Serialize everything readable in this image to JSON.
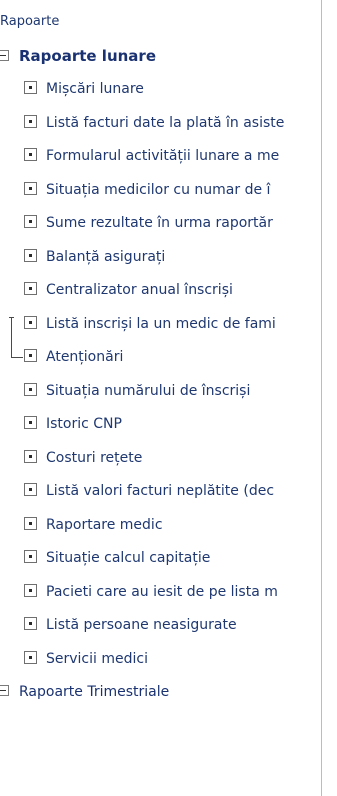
{
  "tree": {
    "root_label": "Rapoarte",
    "groups": [
      {
        "label": "Rapoarte lunare",
        "icon": "collapse-box-icon",
        "items": [
          {
            "label": "Mișcări lunare",
            "icon": "report-node-icon"
          },
          {
            "label": "Listă facturi date la plată în asiste",
            "icon": "report-node-icon"
          },
          {
            "label": "Formularul activității lunare a me",
            "icon": "report-node-icon"
          },
          {
            "label": "Situația medicilor cu numar de î",
            "icon": "report-node-icon"
          },
          {
            "label": "Sume rezultate în urma raportăr",
            "icon": "report-node-icon"
          },
          {
            "label": "Balanță asigurați",
            "icon": "report-node-icon"
          },
          {
            "label": "Centralizator anual înscriși",
            "icon": "report-node-icon"
          },
          {
            "label": "Listă inscriși la un medic de fami",
            "icon": "report-node-icon"
          },
          {
            "label": "Atenționări",
            "icon": "report-node-icon"
          },
          {
            "label": "Situația numărului de înscriși",
            "icon": "report-node-icon"
          },
          {
            "label": "Istoric CNP",
            "icon": "report-node-icon"
          },
          {
            "label": "Costuri rețete",
            "icon": "report-node-icon"
          },
          {
            "label": "Listă valori facturi neplătite (dec",
            "icon": "report-node-icon"
          },
          {
            "label": "Raportare medic",
            "icon": "report-node-icon"
          },
          {
            "label": "Situație calcul capitație",
            "icon": "report-node-icon"
          },
          {
            "label": "Pacieti care au iesit de pe lista m",
            "icon": "report-node-icon"
          },
          {
            "label": "Listă persoane neasigurate",
            "icon": "report-node-icon"
          },
          {
            "label": "Servicii medici",
            "icon": "report-node-icon"
          }
        ]
      },
      {
        "label": "Rapoarte Trimestriale",
        "icon": "collapse-box-icon"
      }
    ]
  }
}
